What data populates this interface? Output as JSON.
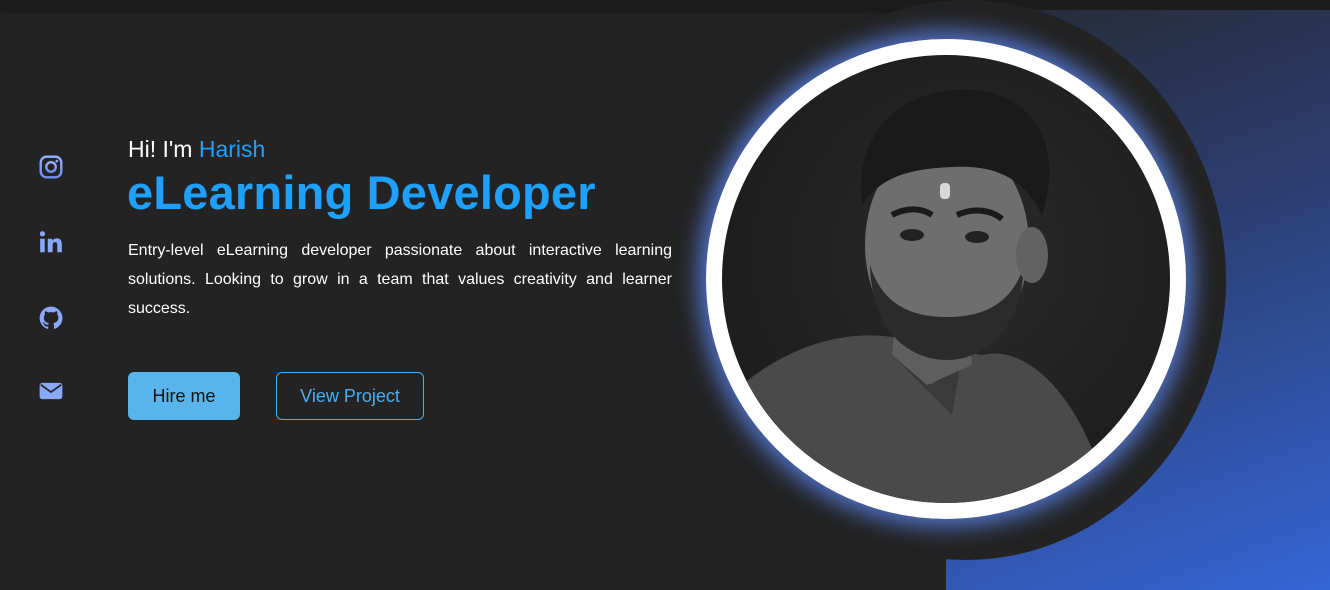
{
  "hero": {
    "greeting_prefix": "Hi! I'm ",
    "name": "Harish",
    "title": "eLearning Developer",
    "description": "Entry-level eLearning developer passionate about interactive learning solutions. Looking to grow in a team that values creativity and learner success.",
    "hire_button": "Hire me",
    "view_button": "View Project"
  },
  "social": [
    {
      "icon": "instagram-icon"
    },
    {
      "icon": "linkedin-icon"
    },
    {
      "icon": "github-icon"
    },
    {
      "icon": "mail-icon"
    }
  ],
  "colors": {
    "background": "#232323",
    "accent": "#1ea0ff",
    "button_fill": "#5ab4ec",
    "icon": "#8aa8f8",
    "gradient_end": "#3565d6",
    "ring": "#ffffff",
    "glow": "#5f8cff"
  }
}
